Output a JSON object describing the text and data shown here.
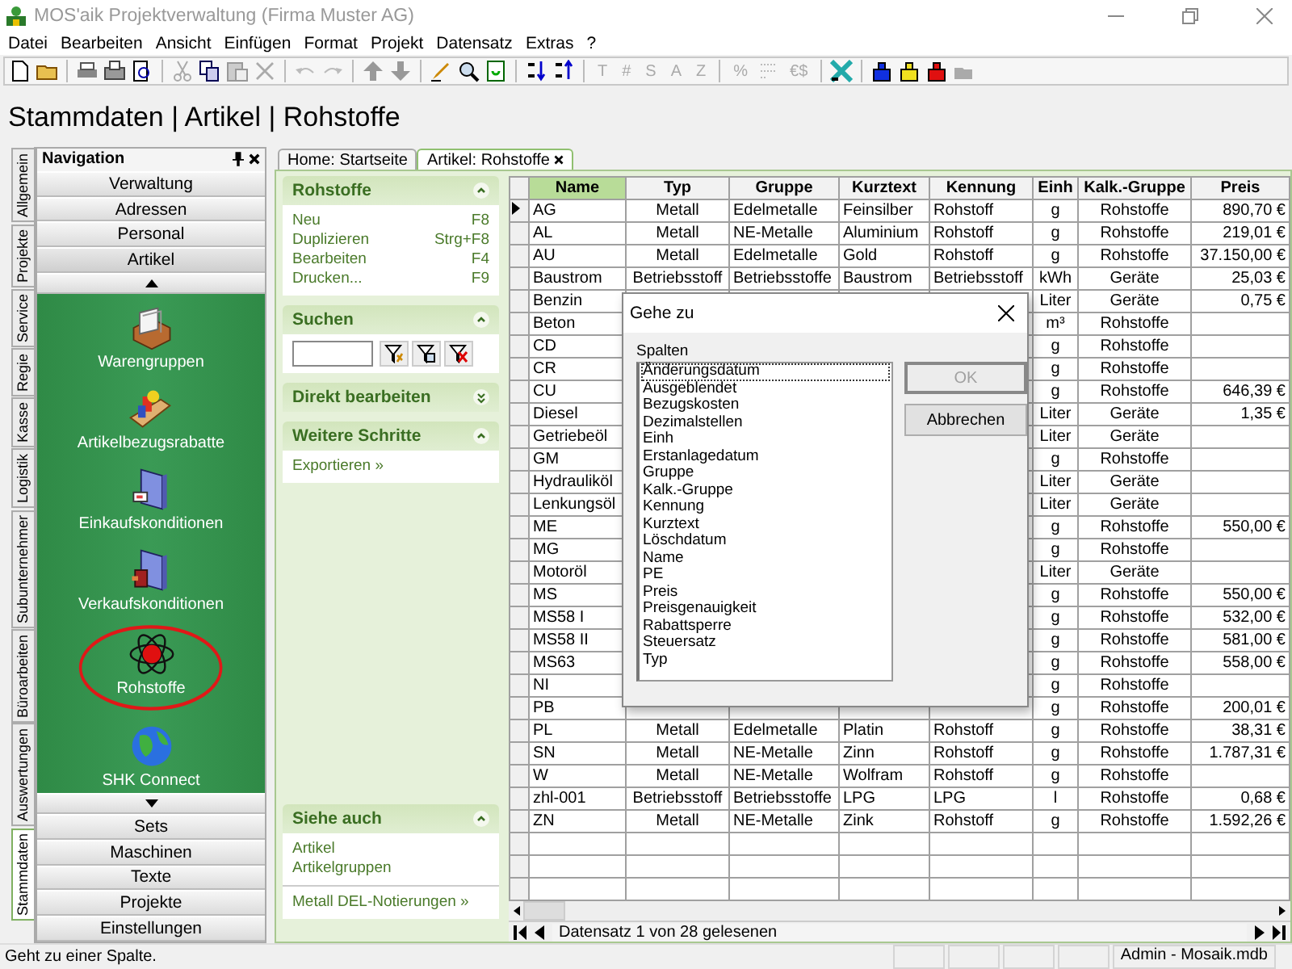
{
  "window": {
    "title": "MOS'aik Projektverwaltung (Firma Muster AG)"
  },
  "menu": [
    "Datei",
    "Bearbeiten",
    "Ansicht",
    "Einfügen",
    "Format",
    "Projekt",
    "Datensatz",
    "Extras",
    "?"
  ],
  "toolbar_format": [
    {
      "kind": "text",
      "label": "T",
      "disabled": true
    },
    {
      "kind": "text",
      "label": "#",
      "disabled": true
    },
    {
      "kind": "text",
      "label": "S",
      "disabled": true
    },
    {
      "kind": "text",
      "label": "A",
      "disabled": true
    },
    {
      "kind": "text",
      "label": "Z",
      "disabled": true
    },
    {
      "kind": "separator"
    },
    {
      "kind": "text",
      "label": "%",
      "disabled": true
    },
    {
      "kind": "numbering",
      "disabled": true
    },
    {
      "kind": "text",
      "label": "€$",
      "disabled": true
    }
  ],
  "heading": "Stammdaten | Artikel | Rohstoffe",
  "side_tabs": [
    {
      "label": "Allgemein",
      "selected": false
    },
    {
      "label": "Projekte",
      "selected": false
    },
    {
      "label": "Service",
      "selected": false
    },
    {
      "label": "Regie",
      "selected": false
    },
    {
      "label": "Kasse",
      "selected": false
    },
    {
      "label": "Logistik",
      "selected": false
    },
    {
      "label": "Subunternehmer",
      "selected": false
    },
    {
      "label": "Büroarbeiten",
      "selected": false
    },
    {
      "label": "Auswertungen",
      "selected": false
    },
    {
      "label": "Stammdaten",
      "selected": true
    }
  ],
  "navigation": {
    "title": "Navigation",
    "groups_top": [
      {
        "label": "Verwaltung",
        "selected": false
      },
      {
        "label": "Adressen",
        "selected": false
      },
      {
        "label": "Personal",
        "selected": false
      },
      {
        "label": "Artikel",
        "selected": true
      }
    ],
    "items": [
      {
        "label": "Warengruppen",
        "kind": "crate",
        "circled": false
      },
      {
        "label": "Artikelbezugsrabatte",
        "kind": "parts",
        "circled": false
      },
      {
        "label": "Einkaufskonditionen",
        "kind": "book",
        "circled": false
      },
      {
        "label": "Verkaufskonditionen",
        "kind": "book-door",
        "circled": false
      },
      {
        "label": "Rohstoffe",
        "kind": "atom",
        "circled": true
      },
      {
        "label": "SHK Connect",
        "kind": "globe",
        "circled": false
      }
    ],
    "groups_bottom": [
      {
        "label": "Sets",
        "selected": false
      },
      {
        "label": "Maschinen",
        "selected": false
      },
      {
        "label": "Texte",
        "selected": false
      },
      {
        "label": "Projekte",
        "selected": false
      },
      {
        "label": "Einstellungen",
        "selected": false
      }
    ]
  },
  "tabs": [
    {
      "label": "Home: Startseite",
      "selected": false,
      "closable": false
    },
    {
      "label": "Artikel: Rohstoffe",
      "selected": true,
      "closable": true
    }
  ],
  "task_panel": {
    "sections": [
      {
        "title": "Rohstoffe",
        "expanded": true,
        "kind": "commands",
        "items": [
          {
            "label": "Neu",
            "shortcut": "F8"
          },
          {
            "label": "Duplizieren",
            "shortcut": "Strg+F8"
          },
          {
            "label": "Bearbeiten",
            "shortcut": "F4"
          },
          {
            "label": "Drucken...",
            "shortcut": "F9"
          }
        ]
      },
      {
        "title": "Suchen",
        "expanded": true,
        "kind": "search"
      },
      {
        "title": "Direkt bearbeiten",
        "expanded": false
      },
      {
        "title": "Weitere Schritte",
        "expanded": true,
        "kind": "commands",
        "items": [
          {
            "label": "Exportieren »"
          }
        ]
      }
    ],
    "see_also": {
      "title": "Siehe auch",
      "expanded": true,
      "items": [
        "Artikel",
        "Artikelgruppen"
      ],
      "footer_link": "Metall DEL-Notierungen »"
    }
  },
  "table": {
    "columns": [
      {
        "label": "Name",
        "selected": true
      },
      {
        "label": "Typ",
        "selected": false
      },
      {
        "label": "Gruppe",
        "selected": false
      },
      {
        "label": "Kurztext",
        "selected": false
      },
      {
        "label": "Kennung",
        "selected": false
      },
      {
        "label": "Einh",
        "selected": false
      },
      {
        "label": "Kalk.-Gruppe",
        "selected": false
      },
      {
        "label": "Preis",
        "selected": false
      }
    ],
    "rows": [
      {
        "current": true,
        "cells": [
          "AG",
          "Metall",
          "Edelmetalle",
          "Feinsilber",
          "Rohstoff",
          "g",
          "Rohstoffe",
          "890,70 €"
        ]
      },
      {
        "current": false,
        "cells": [
          "AL",
          "Metall",
          "NE-Metalle",
          "Aluminium",
          "Rohstoff",
          "g",
          "Rohstoffe",
          "219,01 €"
        ]
      },
      {
        "current": false,
        "cells": [
          "AU",
          "Metall",
          "Edelmetalle",
          "Gold",
          "Rohstoff",
          "g",
          "Rohstoffe",
          "37.150,00 €"
        ]
      },
      {
        "current": false,
        "cells": [
          "Baustrom",
          "Betriebsstoff",
          "Betriebsstoffe",
          "Baustrom",
          "Betriebsstoff",
          "kWh",
          "Geräte",
          "25,03 €"
        ]
      },
      {
        "current": false,
        "cells": [
          "Benzin",
          null,
          null,
          null,
          null,
          "Liter",
          "Geräte",
          "0,75 €"
        ]
      },
      {
        "current": false,
        "cells": [
          "Beton",
          null,
          null,
          null,
          null,
          "m³",
          "Rohstoffe",
          null
        ]
      },
      {
        "current": false,
        "cells": [
          "CD",
          null,
          null,
          null,
          null,
          "g",
          "Rohstoffe",
          null
        ]
      },
      {
        "current": false,
        "cells": [
          "CR",
          null,
          null,
          null,
          null,
          "g",
          "Rohstoffe",
          null
        ]
      },
      {
        "current": false,
        "cells": [
          "CU",
          null,
          null,
          null,
          null,
          "g",
          "Rohstoffe",
          "646,39 €"
        ]
      },
      {
        "current": false,
        "cells": [
          "Diesel",
          null,
          null,
          null,
          null,
          "Liter",
          "Geräte",
          "1,35 €"
        ]
      },
      {
        "current": false,
        "cells": [
          "Getriebeöl",
          null,
          null,
          null,
          null,
          "Liter",
          "Geräte",
          null
        ]
      },
      {
        "current": false,
        "cells": [
          "GM",
          null,
          null,
          null,
          null,
          "g",
          "Rohstoffe",
          null
        ]
      },
      {
        "current": false,
        "cells": [
          "Hydrauliköl",
          null,
          null,
          null,
          null,
          "Liter",
          "Geräte",
          null
        ]
      },
      {
        "current": false,
        "cells": [
          "Lenkungsöl",
          null,
          null,
          null,
          null,
          "Liter",
          "Geräte",
          null
        ]
      },
      {
        "current": false,
        "cells": [
          "ME",
          null,
          null,
          null,
          null,
          "g",
          "Rohstoffe",
          "550,00 €"
        ]
      },
      {
        "current": false,
        "cells": [
          "MG",
          null,
          null,
          null,
          null,
          "g",
          "Rohstoffe",
          null
        ]
      },
      {
        "current": false,
        "cells": [
          "Motoröl",
          null,
          null,
          null,
          null,
          "Liter",
          "Geräte",
          null
        ]
      },
      {
        "current": false,
        "cells": [
          "MS",
          null,
          null,
          null,
          null,
          "g",
          "Rohstoffe",
          "550,00 €"
        ]
      },
      {
        "current": false,
        "cells": [
          "MS58 I",
          null,
          null,
          null,
          null,
          "g",
          "Rohstoffe",
          "532,00 €"
        ]
      },
      {
        "current": false,
        "cells": [
          "MS58 II",
          null,
          null,
          null,
          null,
          "g",
          "Rohstoffe",
          "581,00 €"
        ]
      },
      {
        "current": false,
        "cells": [
          "MS63",
          null,
          null,
          null,
          null,
          "g",
          "Rohstoffe",
          "558,00 €"
        ]
      },
      {
        "current": false,
        "cells": [
          "NI",
          null,
          null,
          null,
          null,
          "g",
          "Rohstoffe",
          null
        ]
      },
      {
        "current": false,
        "cells": [
          "PB",
          null,
          null,
          null,
          null,
          "g",
          "Rohstoffe",
          "200,01 €"
        ]
      },
      {
        "current": false,
        "cells": [
          "PL",
          "Metall",
          "Edelmetalle",
          "Platin",
          "Rohstoff",
          "g",
          "Rohstoffe",
          "38,31 €"
        ]
      },
      {
        "current": false,
        "cells": [
          "SN",
          "Metall",
          "NE-Metalle",
          "Zinn",
          "Rohstoff",
          "g",
          "Rohstoffe",
          "1.787,31 €"
        ]
      },
      {
        "current": false,
        "cells": [
          "W",
          "Metall",
          "NE-Metalle",
          "Wolfram",
          "Rohstoff",
          "g",
          "Rohstoffe",
          null
        ]
      },
      {
        "current": false,
        "cells": [
          "zhl-001",
          "Betriebsstoff",
          "Betriebsstoffe",
          "LPG",
          "LPG",
          "l",
          "Rohstoffe",
          "0,68 €"
        ]
      },
      {
        "current": false,
        "cells": [
          "ZN",
          "Metall",
          "NE-Metalle",
          "Zink",
          "Rohstoff",
          "g",
          "Rohstoffe",
          "1.592,26 €"
        ]
      }
    ]
  },
  "record_nav": {
    "text": "Datensatz 1 von 28 gelesenen"
  },
  "dialog": {
    "title": "Gehe zu",
    "label": "Spalten",
    "items": [
      {
        "label": "Änderungsdatum",
        "selected": true
      },
      {
        "label": "Ausgeblendet",
        "selected": false
      },
      {
        "label": "Bezugskosten",
        "selected": false
      },
      {
        "label": "Dezimalstellen",
        "selected": false
      },
      {
        "label": "Einh",
        "selected": false
      },
      {
        "label": "Erstanlagedatum",
        "selected": false
      },
      {
        "label": "Gruppe",
        "selected": false
      },
      {
        "label": "Kalk.-Gruppe",
        "selected": false
      },
      {
        "label": "Kennung",
        "selected": false
      },
      {
        "label": "Kurztext",
        "selected": false
      },
      {
        "label": "Löschdatum",
        "selected": false
      },
      {
        "label": "Name",
        "selected": false
      },
      {
        "label": "PE",
        "selected": false
      },
      {
        "label": "Preis",
        "selected": false
      },
      {
        "label": "Preisgenauigkeit",
        "selected": false
      },
      {
        "label": "Rabattsperre",
        "selected": false
      },
      {
        "label": "Steuersatz",
        "selected": false
      },
      {
        "label": "Typ",
        "selected": false
      }
    ],
    "buttons": [
      {
        "label": "OK",
        "disabled": true
      },
      {
        "label": "Abbrechen",
        "disabled": false
      }
    ]
  },
  "status_bar": {
    "text": "Geht zu einer Spalte.",
    "panels": [
      "Admin - Mosaik.mdb"
    ]
  }
}
